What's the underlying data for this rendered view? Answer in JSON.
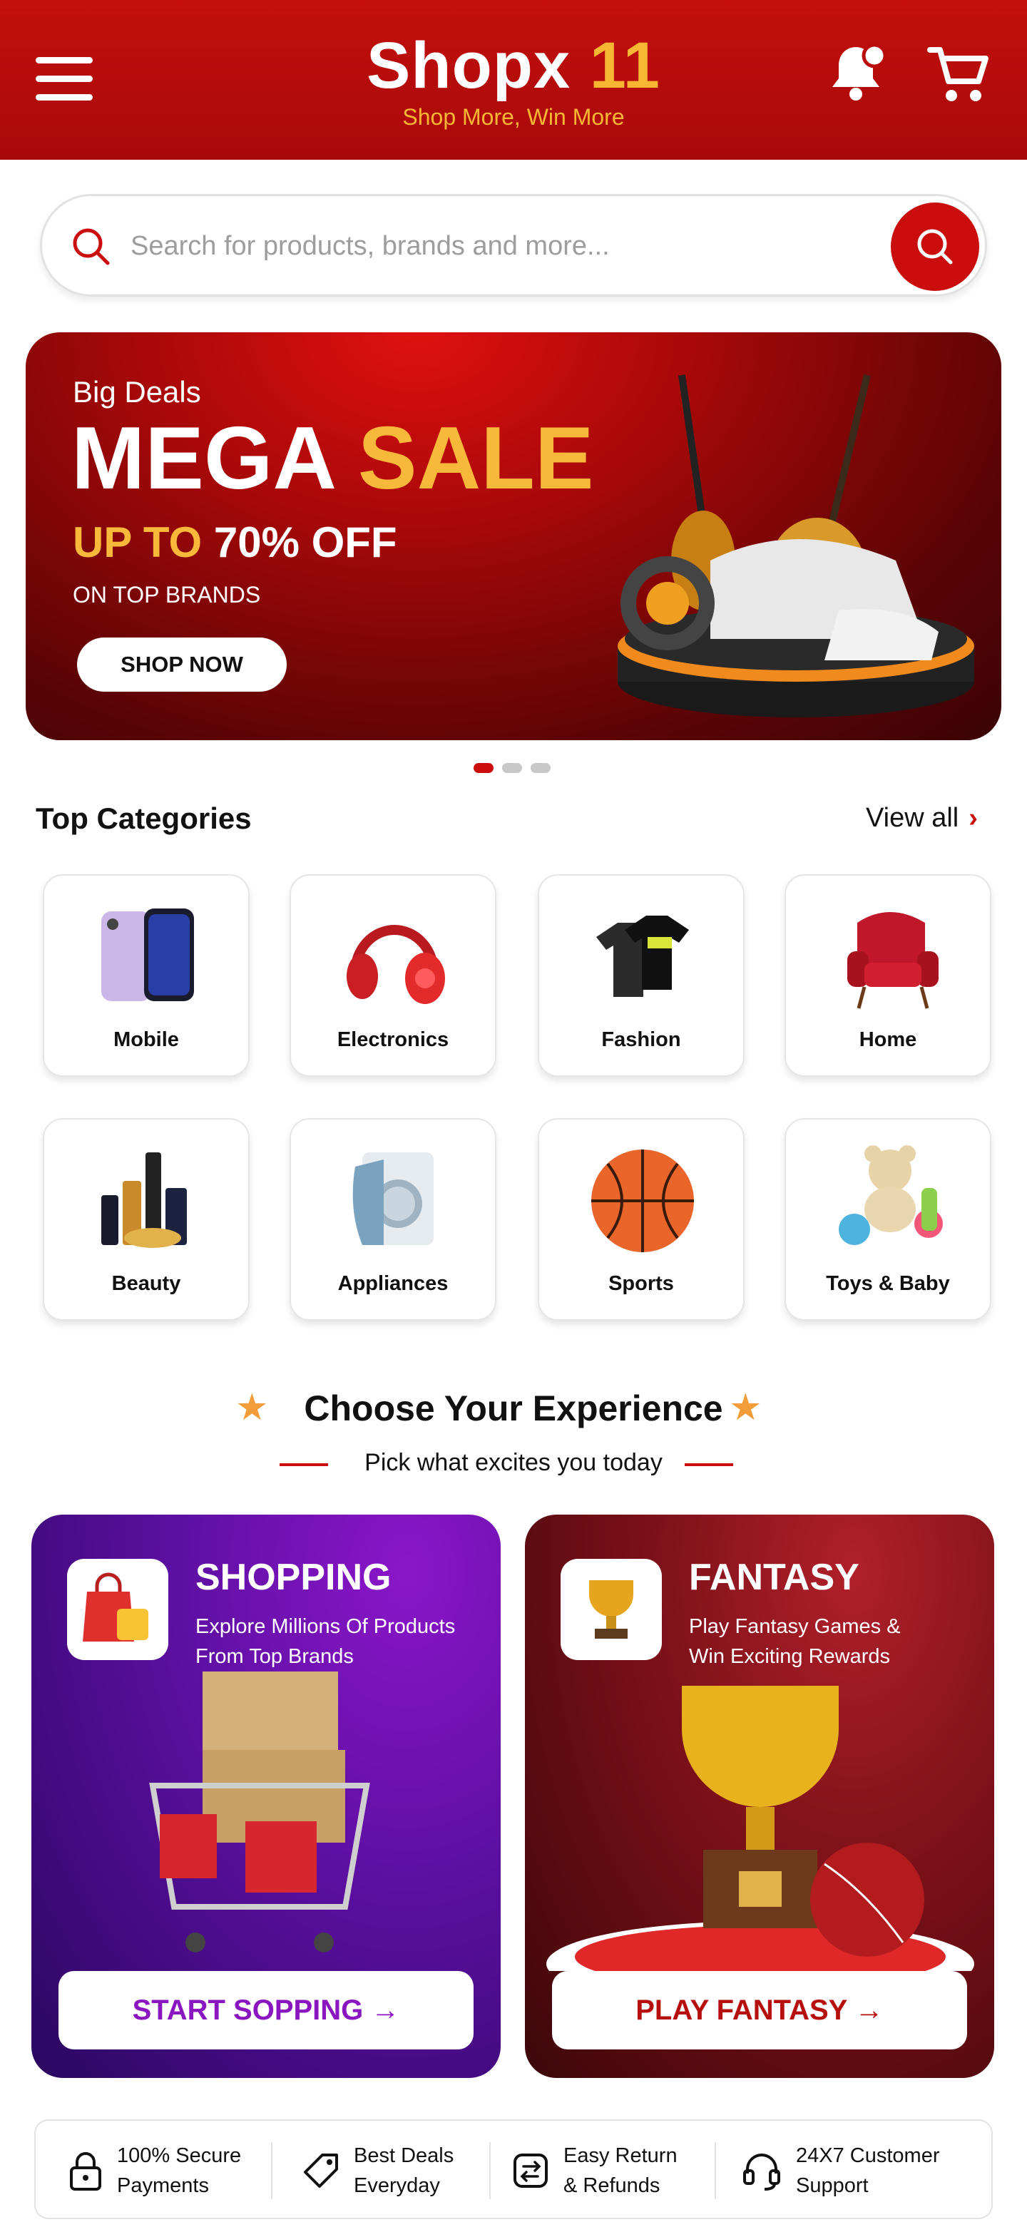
{
  "header": {
    "brand_name": "Shopx",
    "brand_number": "11",
    "tagline": "Shop More, Win More",
    "colors": {
      "primary": "#b90c0b",
      "accent": "#f7b733"
    },
    "icons": [
      "menu-icon",
      "bell-icon",
      "cart-icon"
    ]
  },
  "search": {
    "placeholder": "Search for products, brands and more..."
  },
  "banner": {
    "small": "Big Deals",
    "big_white": "MEGA",
    "big_yellow": "SALE",
    "off_yellow": "UP TO",
    "off_white": "70% OFF",
    "brands": "ON TOP BRANDS",
    "button": "SHOP NOW",
    "active_slide": 1,
    "slide_count": 3
  },
  "categories": {
    "title": "Top Categories",
    "view_all": "View all",
    "items": [
      {
        "label": "Mobile",
        "icon": "mobile-phones-icon"
      },
      {
        "label": "Electronics",
        "icon": "headphones-icon"
      },
      {
        "label": "Fashion",
        "icon": "tshirts-icon"
      },
      {
        "label": "Home",
        "icon": "armchair-icon"
      },
      {
        "label": "Beauty",
        "icon": "cosmetics-icon"
      },
      {
        "label": "Appliances",
        "icon": "washing-machine-icon"
      },
      {
        "label": "Sports",
        "icon": "basketball-icon"
      },
      {
        "label": "Toys & Baby",
        "icon": "teddy-bear-icon"
      }
    ]
  },
  "experience": {
    "title": "Choose Your Experience",
    "subtitle": "Pick what excites you today",
    "shopping": {
      "title": "SHOPPING",
      "line1": "Explore Millions Of Products",
      "line2": "From Top Brands",
      "button": "START SOPPING"
    },
    "fantasy": {
      "title": "FANTASY",
      "line1": "Play Fantasy Games &",
      "line2": "Win Exciting Rewards",
      "button": "PLAY FANTASY"
    }
  },
  "features": [
    {
      "line1": "100% Secure",
      "line2": "Payments",
      "icon": "lock-icon"
    },
    {
      "line1": "Best Deals",
      "line2": "Everyday",
      "icon": "tag-icon"
    },
    {
      "line1": "Easy Return",
      "line2": "& Refunds",
      "icon": "return-icon"
    },
    {
      "line1": "24X7 Customer",
      "line2": "Support",
      "icon": "headset-icon"
    }
  ]
}
